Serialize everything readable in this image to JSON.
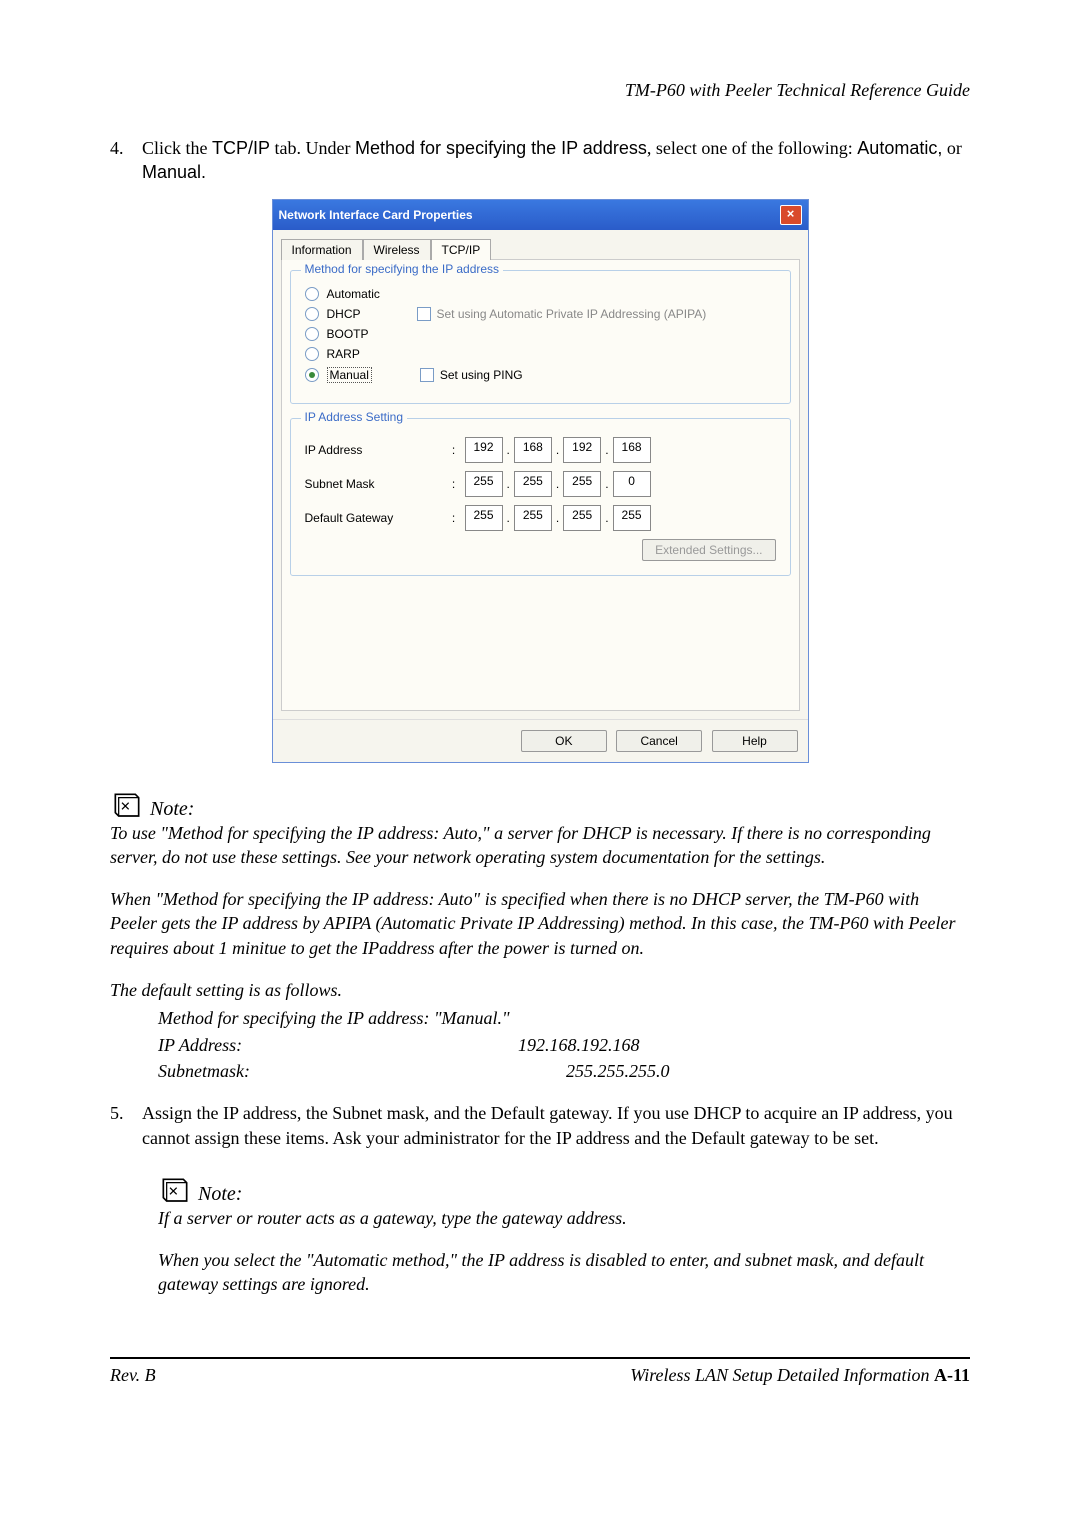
{
  "header": {
    "doc_title": "TM-P60 with Peeler Technical Reference Guide"
  },
  "step4": {
    "num": "4.",
    "t1": "Click the ",
    "t2": "TCP/IP",
    "t3": " tab. Under ",
    "t4": "Method for specifying the IP address",
    "t5": ", select one of the following: ",
    "t6": "Automatic,",
    "t7": " or ",
    "t8": "Manual."
  },
  "dialog": {
    "title": "Network Interface Card Properties",
    "tabs": {
      "info": "Information",
      "wireless": "Wireless",
      "tcpip": "TCP/IP"
    },
    "method": {
      "legend": "Method for specifying the IP address",
      "automatic": "Automatic",
      "dhcp": "DHCP",
      "bootp": "BOOTP",
      "rarp": "RARP",
      "manual": "Manual",
      "apipa": "Set using Automatic Private IP Addressing (APIPA)",
      "ping": "Set using PING"
    },
    "ip": {
      "legend": "IP Address Setting",
      "ip_label": "IP Address",
      "subnet_label": "Subnet Mask",
      "gateway_label": "Default Gateway",
      "ip": [
        "192",
        "168",
        "192",
        "168"
      ],
      "subnet": [
        "255",
        "255",
        "255",
        "0"
      ],
      "gateway": [
        "255",
        "255",
        "255",
        "255"
      ]
    },
    "extended": "Extended Settings...",
    "ok": "OK",
    "cancel": "Cancel",
    "help": "Help"
  },
  "note1": {
    "label": "Note:",
    "p1": "To use \"Method for specifying the IP address: Auto,\"  a server for DHCP is necessary. If there is no corresponding server, do not use these settings. See your network operating system documentation for the settings.",
    "p2": "When \"Method for specifying the IP address: Auto\" is specified when there is no DHCP server, the TM-P60 with Peeler gets the IP address by APIPA (Automatic Private IP Addressing) method. In this case, the TM-P60 with Peeler requires about 1 minitue to get the IPaddress after the power is turned on.",
    "p3": "The default setting is as follows.",
    "line1": "Method for specifying the IP address: \"Manual.\"",
    "ip_l": "IP Address:",
    "ip_v": "192.168.192.168",
    "sub_l": " Subnetmask:",
    "sub_v": "255.255.255.0"
  },
  "step5": {
    "num": "5.",
    "text": "Assign the IP address, the Subnet mask, and the Default gateway. If you use DHCP to acquire an IP address, you cannot assign these items. Ask your administrator for the IP address and the Default gateway to be set."
  },
  "note2": {
    "label": "Note:",
    "p1": "If a server or router acts as a gateway, type the gateway address.",
    "p2": "When you select the \"Automatic method,\" the IP address is disabled to enter, and subnet mask, and default gateway settings are ignored."
  },
  "footer": {
    "left": "Rev. B",
    "right_a": "Wireless LAN Setup Detailed Information   ",
    "right_b": "A-11"
  }
}
